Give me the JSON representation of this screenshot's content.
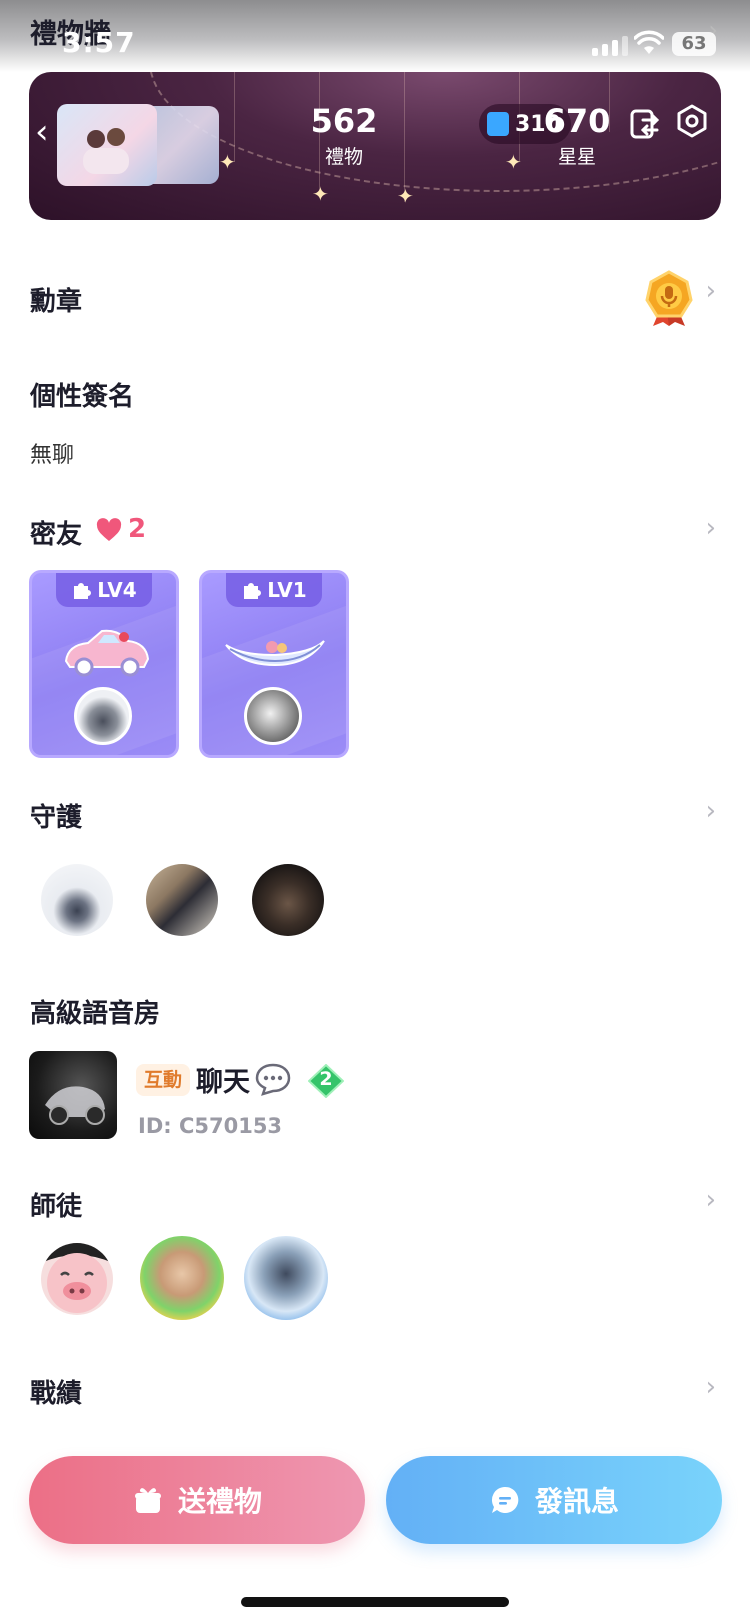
{
  "status_bar": {
    "time": "3:57",
    "battery": "63"
  },
  "gift_wall": {
    "title": "禮物牆",
    "gifts_count": "562",
    "gifts_label": "禮物",
    "stars_count": "670",
    "stars_label": "星星",
    "pill_value": "310"
  },
  "sections": {
    "medals": "勳章",
    "signature_title": "個性簽名",
    "signature_text": "無聊",
    "close_friends": "密友",
    "close_friends_count": "2",
    "guardian": "守護",
    "premium_room": "高級語音房",
    "mentorship": "師徒",
    "records": "戰績"
  },
  "close_friend_cards": [
    {
      "level": "LV4",
      "gift_icon": "pink-car-icon"
    },
    {
      "level": "LV1",
      "gift_icon": "gondola-boat-icon"
    }
  ],
  "premium_room": {
    "tag": "互動",
    "name": "聊天",
    "level": "2",
    "id": "ID: C570153"
  },
  "buttons": {
    "send_gift": "送禮物",
    "send_message": "發訊息"
  },
  "colors": {
    "gift_button": "#ec6f86",
    "message_button": "#63b0f6",
    "heart": "#f0577b",
    "card_purple": "#8c7cf2"
  }
}
